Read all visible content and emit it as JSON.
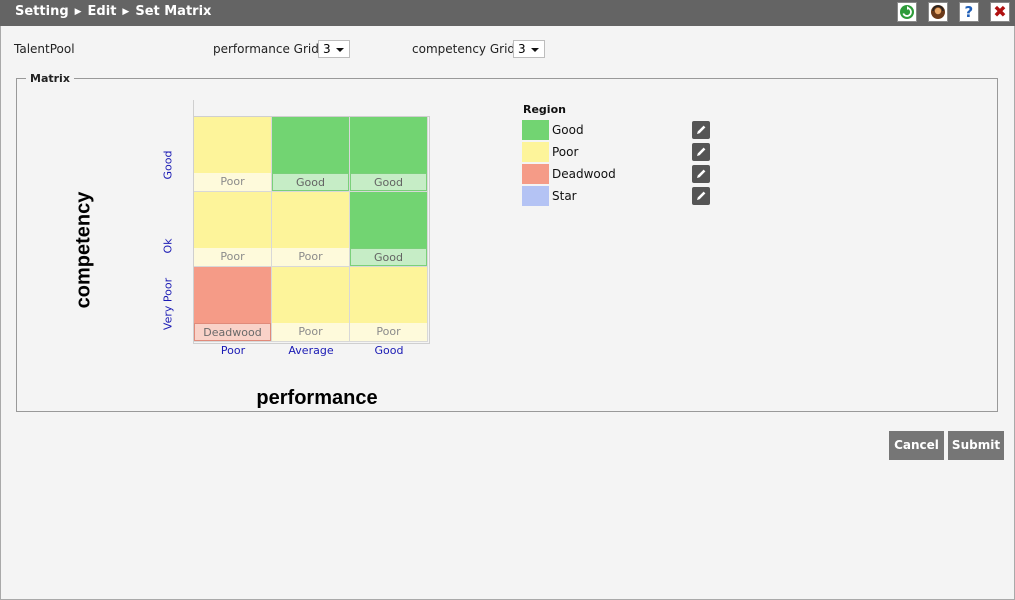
{
  "breadcrumb": [
    "Setting",
    "Edit",
    "Set Matrix"
  ],
  "form": {
    "talentpool_label": "TalentPool",
    "perf_grid_label": "performance Grid",
    "perf_grid_value": "3",
    "comp_grid_label": "competency Grid",
    "comp_grid_value": "3"
  },
  "matrix": {
    "legend": "Matrix",
    "y_title": "competency",
    "x_title": "performance",
    "y_labels": [
      "Good",
      "Ok",
      "Very Poor"
    ],
    "x_labels": [
      "Poor",
      "Average",
      "Good"
    ],
    "cells": [
      [
        "Poor",
        "Good",
        "Good"
      ],
      [
        "Poor",
        "Poor",
        "Good"
      ],
      [
        "Deadwood",
        "Poor",
        "Poor"
      ]
    ]
  },
  "regions": {
    "header": "Region",
    "items": [
      {
        "name": "Good",
        "color": "#72d472"
      },
      {
        "name": "Poor",
        "color": "#fdf49a"
      },
      {
        "name": "Deadwood",
        "color": "#f59b87"
      },
      {
        "name": "Star",
        "color": "#b4c3f4"
      }
    ]
  },
  "buttons": {
    "cancel": "Cancel",
    "submit": "Submit"
  }
}
